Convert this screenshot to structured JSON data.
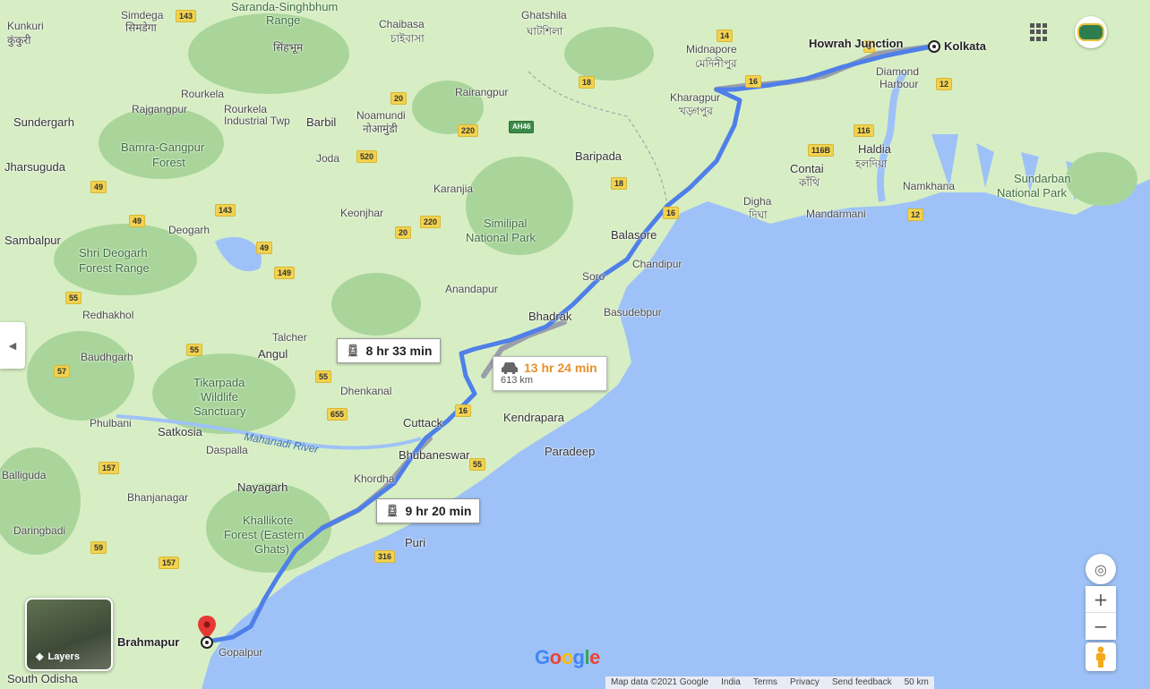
{
  "map": {
    "colors": {
      "sea": "#9ec2f7",
      "land": "#d7eec4",
      "forest": "#a9d59a",
      "route_primary": "#4f7fe8",
      "route_alt": "#9a9fa8"
    },
    "origin": {
      "name": "Kolkata",
      "station": "Howrah Junction"
    },
    "destination": {
      "name": "Brahmapur"
    },
    "routes": {
      "train_1": {
        "icon": "train-icon",
        "duration": "8 hr 33 min"
      },
      "train_2": {
        "icon": "train-icon",
        "duration": "9 hr 20 min"
      },
      "drive": {
        "icon": "car-icon",
        "duration": "13 hr 24 min",
        "distance": "613 km"
      }
    },
    "places": {
      "kunkuri": "Kunkuri",
      "kunkuri_hi": "कुंकुरी",
      "simdega": "Simdega",
      "simdega_hi": "सिमडेगा",
      "saranda": "Saranda-Singhbhum",
      "range": "Range",
      "chaibasa": "Chaibasa",
      "chaibasa_bn": "চাইবাসা",
      "singhbhum_ol": "सिंहभूम",
      "ghatshila": "Ghatshila",
      "ghatshila_bn": "ঘাটশিলা",
      "midnapore": "Midnapore",
      "midnapore_bn": "মেদিনীপুর",
      "kharagpur": "Kharagpur",
      "kharagpur_bn": "খড়্গপুর",
      "diamond_harbour": "Diamond",
      "harbour": "Harbour",
      "rourkela": "Rourkela",
      "rajgangpur": "Rajgangpur",
      "rourkela_it": "Rourkela",
      "industrial": "Industrial Twp",
      "barbil": "Barbil",
      "noamundi": "Noamundi",
      "noamundi_hi": "नोआमुंडी",
      "rairangpur": "Rairangpur",
      "sundergarh": "Sundergarh",
      "bamra": "Bamra-Gangpur",
      "forest": "Forest",
      "joda": "Joda",
      "baripada": "Baripada",
      "contai": "Contai",
      "contai_bn": "কাঁথি",
      "haldia": "Haldia",
      "haldia_bn": "হলদিয়া",
      "sundarban": "Sundarban",
      "national_park": "National Park",
      "jharsuguda": "Jharsuguda",
      "karanjia": "Karanjia",
      "keonjhar": "Keonjhar",
      "simlipal": "Similipal",
      "simlipal_np": "National Park",
      "digha": "Digha",
      "digha_bn": "দিঘা",
      "namkhana": "Namkhana",
      "mandarmani": "Mandarmani",
      "deogarh": "Deogarh",
      "sambalpur": "Sambalpur",
      "shri_deogarh": "Shri Deogarh",
      "forest_range": "Forest Range",
      "balasore": "Balasore",
      "chandipur": "Chandipur",
      "soro": "Soro",
      "anandapur": "Anandapur",
      "redhakhol": "Redhakhol",
      "bhadrak": "Bhadrak",
      "basudebpur": "Basudebpur",
      "talcher": "Talcher",
      "angul": "Angul",
      "baudhgarh": "Baudhgarh",
      "tikarpada": "Tikarpada",
      "wildlife": "Wildlife",
      "sanctuary": "Sanctuary",
      "dhenkanal": "Dhenkanal",
      "kendrapara": "Kendrapara",
      "cuttack": "Cuttack",
      "phulbani": "Phulbani",
      "satkosia": "Satkosia",
      "daspalla": "Daspalla",
      "mahanadi": "Mahanadi River",
      "bhubaneswar": "Bhubaneswar",
      "paradeep": "Paradeep",
      "balliguda": "Balliguda",
      "khordha": "Khordha",
      "nayagarh": "Nayagarh",
      "bhanjanagar": "Bhanjanagar",
      "khallikote": "Khallikote",
      "forest_eastern": "Forest (Eastern",
      "ghats": "Ghats)",
      "daringbadi": "Daringbadi",
      "puri": "Puri",
      "gopalpur": "Gopalpur",
      "south_odisha": "South Odisha"
    },
    "highways": [
      "143",
      "14",
      "6",
      "16",
      "12",
      "20",
      "18",
      "220",
      "AH46",
      "520",
      "116",
      "116B",
      "49",
      "143",
      "49",
      "18",
      "16",
      "12",
      "220",
      "20",
      "49",
      "149",
      "55",
      "55",
      "57",
      "55",
      "655",
      "16",
      "55",
      "157",
      "59",
      "157",
      "316"
    ],
    "controls": {
      "layers_label": "Layers",
      "zoom_in": "+",
      "zoom_out": "−"
    },
    "branding": {
      "logo": "Google"
    },
    "attribution": [
      "Map data ©2021 Google",
      "India",
      "Terms",
      "Privacy",
      "Send feedback",
      "50 km"
    ]
  }
}
